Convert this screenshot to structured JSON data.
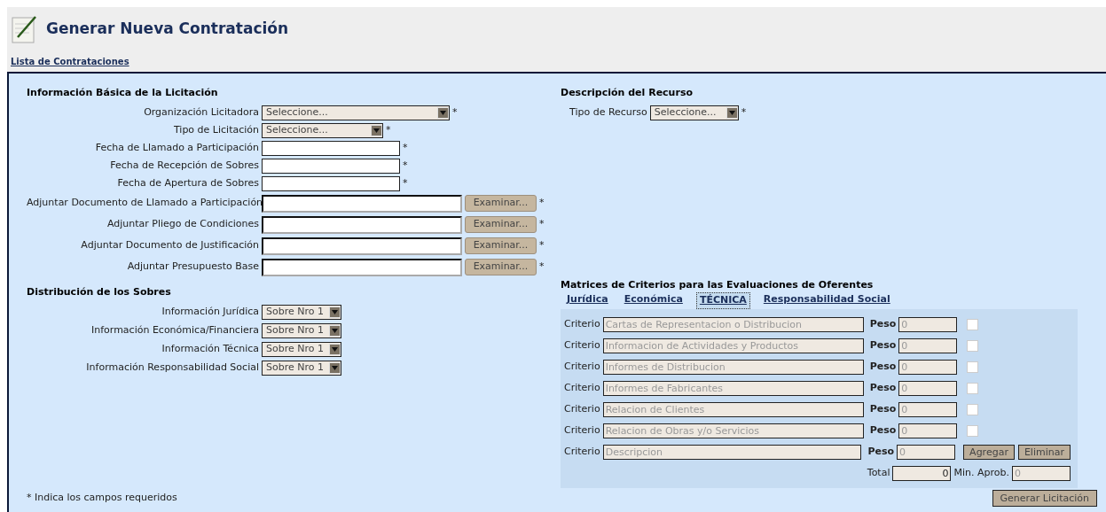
{
  "header": {
    "title": "Generar Nueva Contratación",
    "link": "Lista de Contrataciones"
  },
  "basic_info": {
    "heading": "Información Básica de la Licitación",
    "fields": [
      {
        "kind": "select",
        "label": "Organización Licitadora",
        "value": "Seleccione...",
        "mark": "*"
      },
      {
        "kind": "select",
        "label": "Tipo de Licitación",
        "value": "Seleccione...",
        "mark": "*"
      },
      {
        "kind": "date",
        "label": "Fecha de Llamado a Participación",
        "mark": "*"
      },
      {
        "kind": "date",
        "label": "Fecha de Recepción de Sobres",
        "mark": "*"
      },
      {
        "kind": "date",
        "label": "Fecha de Apertura de Sobres",
        "mark": "*"
      },
      {
        "kind": "file",
        "label": "Adjuntar Documento de Llamado a Participación",
        "button": "Examinar...",
        "mark": "*"
      },
      {
        "kind": "file",
        "label": "Adjuntar Pliego de Condiciones",
        "button": "Examinar...",
        "mark": "*"
      },
      {
        "kind": "file",
        "label": "Adjuntar Documento de Justificación",
        "button": "Examinar...",
        "mark": "*"
      },
      {
        "kind": "file",
        "label": "Adjuntar Presupuesto Base",
        "button": "Examinar...",
        "mark": "*"
      }
    ]
  },
  "distribution": {
    "heading": "Distribución de los Sobres",
    "fields": [
      {
        "label": "Información Jurídica",
        "value": "Sobre Nro 1"
      },
      {
        "label": "Información Económica/Financiera",
        "value": "Sobre Nro 1"
      },
      {
        "label": "Información Técnica",
        "value": "Sobre Nro 1"
      },
      {
        "label": "Información Responsabilidad Social",
        "value": "Sobre Nro 1"
      }
    ]
  },
  "resource": {
    "heading": "Descripción del Recurso",
    "label": "Tipo de Recurso",
    "value": "Seleccione...",
    "mark": "*"
  },
  "matrix": {
    "heading": "Matrices de Criterios para las Evaluaciones de Oferentes",
    "tabs": [
      {
        "label": "Jurídica",
        "selected": false
      },
      {
        "label": "Económica",
        "selected": false
      },
      {
        "label": "TÉCNICA",
        "selected": true
      },
      {
        "label": "Responsabilidad Social",
        "selected": false
      }
    ],
    "rows": [
      {
        "kind": "criterion",
        "label": "Criterio",
        "placeholder": "Cartas de Representacion o Distribucion",
        "weight_label": "Peso",
        "weight_placeholder": "0",
        "checked": false
      },
      {
        "kind": "criterion",
        "label": "Criterio",
        "placeholder": "Informacion de Actividades y Productos",
        "weight_label": "Peso",
        "weight_placeholder": "0",
        "checked": false
      },
      {
        "kind": "criterion",
        "label": "Criterio",
        "placeholder": "Informes de Distribucion",
        "weight_label": "Peso",
        "weight_placeholder": "0",
        "checked": false
      },
      {
        "kind": "criterion",
        "label": "Criterio",
        "placeholder": "Informes de Fabricantes",
        "weight_label": "Peso",
        "weight_placeholder": "0",
        "checked": false
      },
      {
        "kind": "criterion",
        "label": "Criterio",
        "placeholder": "Relacion de Clientes",
        "weight_label": "Peso",
        "weight_placeholder": "0",
        "checked": false
      },
      {
        "kind": "criterion",
        "label": "Criterio",
        "placeholder": "Relacion de Obras y/o Servicios",
        "weight_label": "Peso",
        "weight_placeholder": "0",
        "checked": false
      },
      {
        "kind": "new",
        "label": "Criterio",
        "placeholder": "Descripcion",
        "weight_label": "Peso",
        "weight_placeholder": "0",
        "buttons": [
          "Agregar",
          "Eliminar"
        ]
      }
    ],
    "total_label": "Total",
    "total_value": "0",
    "min_label": "Min. Aprob.",
    "min_placeholder": "0"
  },
  "footnote": "* Indica los campos requeridos",
  "submit": "Generar Licitación"
}
